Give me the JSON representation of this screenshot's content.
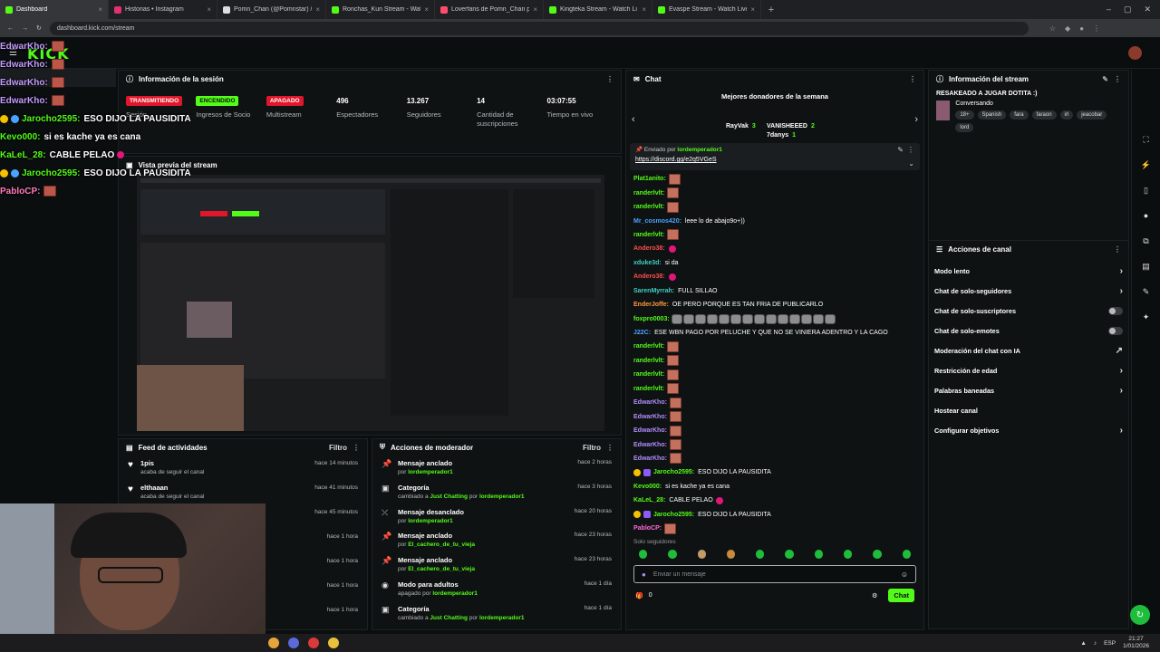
{
  "tabs": [
    {
      "label": "Dashboard",
      "color": "#53fc18"
    },
    {
      "label": "Historias • Instagram",
      "color": "#e1306c"
    },
    {
      "label": "Pomn_Chan (@Pomnstar) / X",
      "color": "#dddddd"
    },
    {
      "label": "Ronchas_Kun Stream - Watch Li",
      "color": "#53fc18"
    },
    {
      "label": "Loverfans de Pomn_Chan perfil",
      "color": "#ff4d6d"
    },
    {
      "label": "Kingteka Stream - Watch Li",
      "color": "#53fc18"
    },
    {
      "label": "Evaspe Stream - Watch Live on",
      "color": "#53fc18"
    }
  ],
  "url": "dashboard.kick.com/stream",
  "logo": "KICK",
  "session": {
    "title": "Información de la sesión",
    "stats": [
      {
        "value": "TRANSMITIENDO",
        "label": "Sesión",
        "kind": "red"
      },
      {
        "value": "ENCENDIDO",
        "label": "Ingresos de Socio",
        "kind": "green"
      },
      {
        "value": "APAGADO",
        "label": "Multistream",
        "kind": "off"
      },
      {
        "value": "496",
        "label": "Espectadores"
      },
      {
        "value": "13.267",
        "label": "Seguidores"
      },
      {
        "value": "14",
        "label": "Cantidad de suscripciones"
      },
      {
        "value": "03:07:55",
        "label": "Tiempo en vivo"
      }
    ]
  },
  "preview": {
    "title": "Vista previa del stream"
  },
  "overlay": [
    {
      "user": "EdwarKho:",
      "kind": "purple"
    },
    {
      "user": "EdwarKho:",
      "kind": "purple"
    },
    {
      "user": "EdwarKho:",
      "kind": "purple"
    },
    {
      "user": "EdwarKho:",
      "kind": "purple"
    },
    {
      "user": "Jarocho2595:",
      "text": "ESO DIJO LA PAUSIDITA",
      "kind": "green",
      "gem": "gold"
    },
    {
      "user": "Kevo000:",
      "text": "si es kache ya es cana",
      "kind": "green"
    },
    {
      "user": "KaLeL_28:",
      "text": "CABLE PELAO",
      "kind": "green",
      "heart": true
    },
    {
      "user": "Jarocho2595:",
      "text": "ESO DIJO LA PAUSIDITA",
      "kind": "green",
      "gem": "gold"
    },
    {
      "user": "PabloCP:",
      "kind": "pink"
    }
  ],
  "feed": {
    "title": "Feed de actividades",
    "filter": "Filtro",
    "items": [
      {
        "user": "1pis",
        "desc": "acaba de seguir el canal",
        "time": "hace 14 minutos"
      },
      {
        "user": "elthaaan",
        "desc": "acaba de seguir el canal",
        "time": "hace 41 minutos"
      },
      {
        "user": "",
        "desc": "",
        "time": "hace 45 minutos"
      },
      {
        "user": "",
        "desc": "",
        "time": "hace 1 hora"
      },
      {
        "user": "",
        "desc": "",
        "time": "hace 1 hora"
      },
      {
        "user": "",
        "desc": "",
        "time": "hace 1 hora"
      },
      {
        "user": "",
        "desc": "",
        "time": "hace 1 hora"
      }
    ]
  },
  "mod": {
    "title": "Acciones de moderador",
    "filter": "Filtro",
    "items": [
      {
        "icon": "pin",
        "title": "Mensaje anclado",
        "pre": "por",
        "user": "lordemperador1",
        "mid": "",
        "user2": "",
        "time": "hace 2 horas"
      },
      {
        "icon": "category",
        "title": "Categoría",
        "pre": "cambiado a",
        "user": "Just Chatting",
        "mid": "por",
        "user2": "lordemperador1",
        "time": "hace 3 horas"
      },
      {
        "icon": "unpin",
        "title": "Mensaje desanclado",
        "pre": "por",
        "user": "lordemperador1",
        "mid": "",
        "user2": "",
        "time": "hace 20 horas"
      },
      {
        "icon": "pin",
        "title": "Mensaje anclado",
        "pre": "por",
        "user": "El_cachero_de_tu_vieja",
        "mid": "",
        "user2": "",
        "time": "hace 23 horas"
      },
      {
        "icon": "pin",
        "title": "Mensaje anclado",
        "pre": "por",
        "user": "El_cachero_de_tu_vieja",
        "mid": "",
        "user2": "",
        "time": "hace 23 horas"
      },
      {
        "icon": "eye",
        "title": "Modo para adultos",
        "pre": "apagado por",
        "user": "lordemperador1",
        "mid": "",
        "user2": "",
        "time": "hace 1 día"
      },
      {
        "icon": "category",
        "title": "Categoría",
        "pre": "cambiado a",
        "user": "Just Chatting",
        "mid": "por",
        "user2": "lordemperador1",
        "time": "hace 1 día"
      }
    ]
  },
  "chat": {
    "title": "Chat",
    "donors_title": "Mejores donadores de la semana",
    "donors": [
      {
        "name": "RayVak",
        "n": "3"
      },
      {
        "name": "VANISHEEED",
        "n": "2"
      },
      {
        "name": "7danys",
        "n": "1"
      }
    ],
    "pinned_by": "Enviado por",
    "pinned_user": "lordemperador1",
    "pinned_link": "https://discord.gg/e2q5VGeS",
    "messages": [
      {
        "user": "Plat1anito:",
        "text": "",
        "color": "c-green",
        "emo": 1
      },
      {
        "user": "randerlvlt:",
        "text": "",
        "color": "c-green",
        "emo": 1
      },
      {
        "user": "randerlvlt:",
        "text": "",
        "color": "c-green",
        "emo": 1
      },
      {
        "user": "Mr_cosmos420:",
        "text": "leee lo de abajo9o+))",
        "color": "c-blue"
      },
      {
        "user": "randerlvlt:",
        "text": "",
        "color": "c-green",
        "emo": 1
      },
      {
        "user": "Andero38:",
        "text": "",
        "color": "c-red",
        "heart": true
      },
      {
        "user": "xduke3d:",
        "text": "si da",
        "color": "c-teal"
      },
      {
        "user": "Andero38:",
        "text": "",
        "color": "c-red",
        "heart": true
      },
      {
        "user": "SarenMyrrah:",
        "text": "FULL SILLAO",
        "color": "c-teal"
      },
      {
        "user": "EnderJoffe:",
        "text": "OE PERO PORQUE ES TAN FRIA DE PUBLICARLO",
        "color": "c-orange"
      },
      {
        "user": "foxpro0003:",
        "text": "",
        "color": "c-green",
        "gray": 14
      },
      {
        "user": "J22C:",
        "text": "ESE WBN PAGO POR PELUCHE Y QUE NO SE VINIERA ADENTRO Y LA CAGO",
        "color": "c-blue"
      },
      {
        "user": "randerlvlt:",
        "text": "",
        "color": "c-green",
        "emo": 1
      },
      {
        "user": "randerlvlt:",
        "text": "",
        "color": "c-green",
        "emo": 1
      },
      {
        "user": "randerlvlt:",
        "text": "",
        "color": "c-green",
        "emo": 1
      },
      {
        "user": "randerlvlt:",
        "text": "",
        "color": "c-green",
        "emo": 1
      },
      {
        "user": "EdwarKho:",
        "text": "",
        "color": "c-purple",
        "emo": 1
      },
      {
        "user": "EdwarKho:",
        "text": "",
        "color": "c-purple",
        "emo": 1
      },
      {
        "user": "EdwarKho:",
        "text": "",
        "color": "c-purple",
        "emo": 1
      },
      {
        "user": "EdwarKho:",
        "text": "",
        "color": "c-purple",
        "emo": 1
      },
      {
        "user": "EdwarKho:",
        "text": "",
        "color": "c-purple",
        "emo": 1
      },
      {
        "user": "Jarocho2595:",
        "text": "ESO DIJO LA PAUSIDITA",
        "color": "c-green",
        "badges": true
      },
      {
        "user": "Kevo000:",
        "text": "si es kache ya es cana",
        "color": "c-green"
      },
      {
        "user": "KaLeL_28:",
        "text": "CABLE PELAO",
        "color": "c-green",
        "heart": true
      },
      {
        "user": "Jarocho2595:",
        "text": "ESO DIJO LA PAUSIDITA",
        "color": "c-green",
        "badges": true
      },
      {
        "user": "PabloCP:",
        "text": "",
        "color": "c-pink",
        "emo": 1
      }
    ],
    "solo": "Solo seguidores",
    "placeholder": "Enviar un mensaje",
    "count": "0",
    "send": "Chat"
  },
  "streaminfo": {
    "title": "Información del stream",
    "stream_title": "RESAKEADO A JUGAR DOTITA :)",
    "category": "Conversando",
    "tags": [
      "18+",
      "Spanish",
      "fara",
      "faraon",
      "irl",
      "jeacobar",
      "lord"
    ]
  },
  "channel": {
    "title": "Acciones de canal",
    "items": [
      {
        "label": "Modo lento",
        "type": "arrow"
      },
      {
        "label": "Chat de solo-seguidores",
        "type": "arrow"
      },
      {
        "label": "Chat de solo-suscriptores",
        "type": "toggle"
      },
      {
        "label": "Chat de solo-emotes",
        "type": "toggle"
      },
      {
        "label": "Moderación del chat con IA",
        "type": "ext"
      },
      {
        "label": "Restricción de edad",
        "type": "arrow"
      },
      {
        "label": "Palabras baneadas",
        "type": "arrow"
      },
      {
        "label": "Hostear canal",
        "type": "none"
      },
      {
        "label": "Configurar objetivos",
        "type": "arrow"
      }
    ]
  },
  "tray": {
    "lang": "ESP",
    "time": "21:27",
    "date": "1/01/2026"
  }
}
